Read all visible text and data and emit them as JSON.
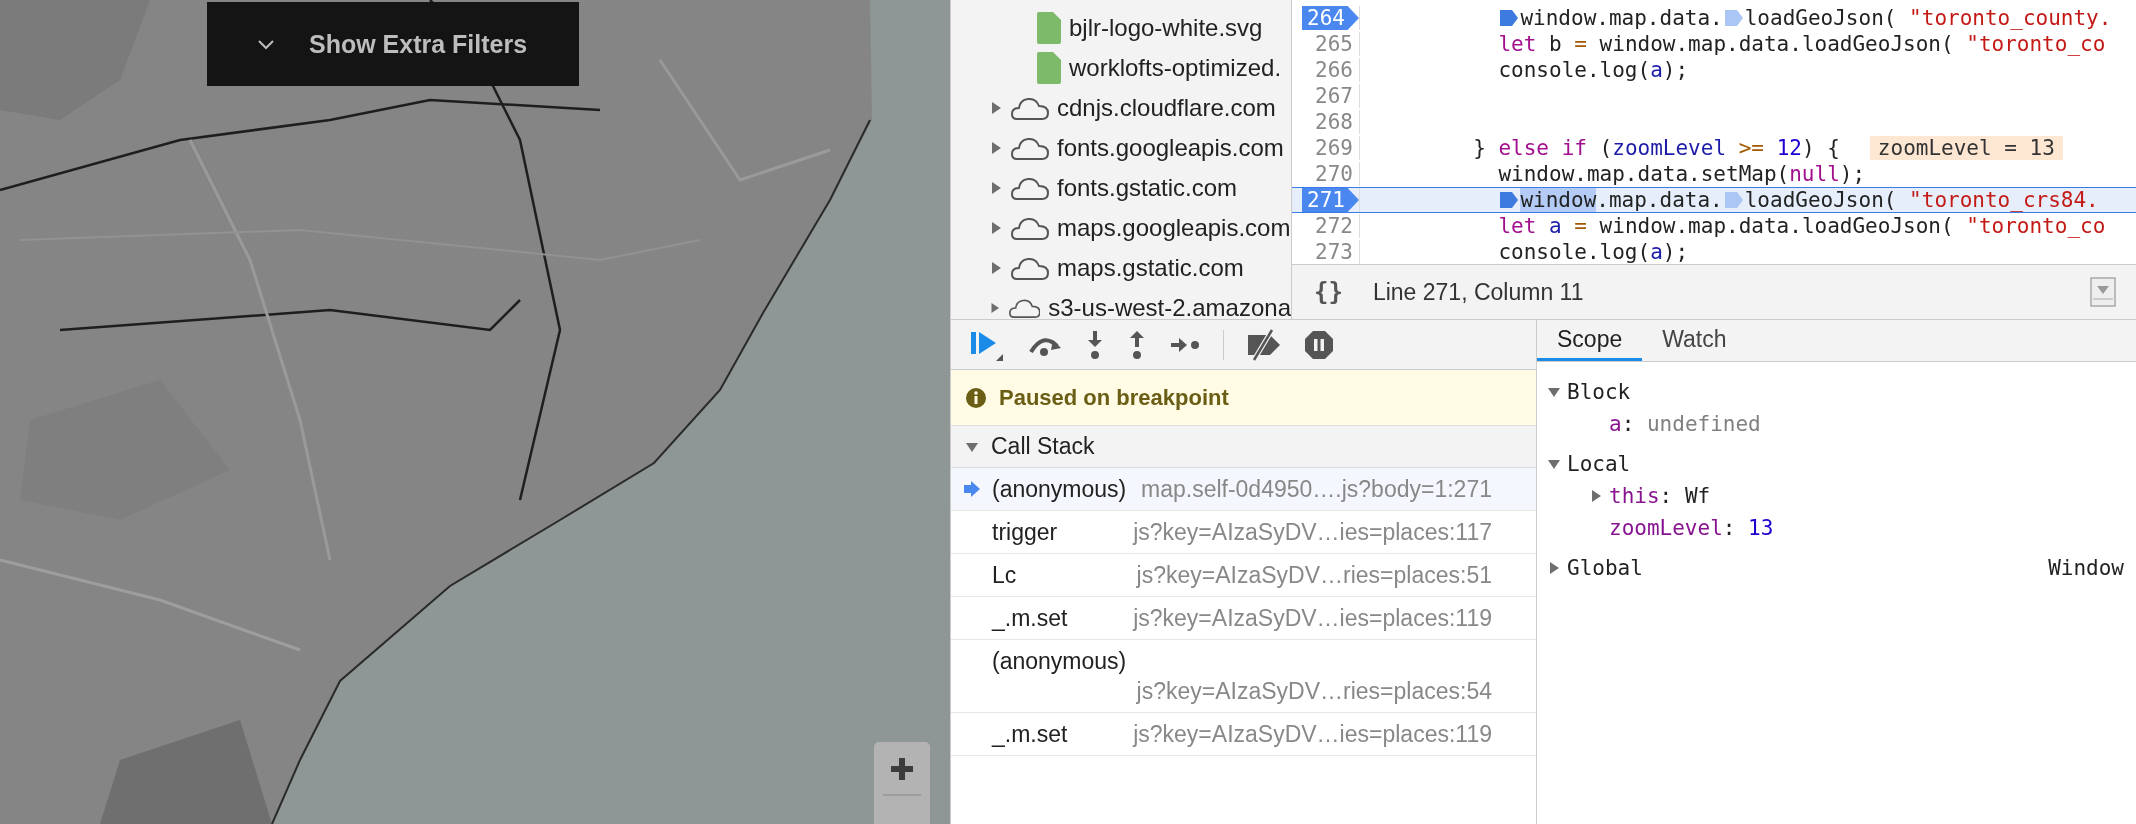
{
  "map": {
    "kind": "picture",
    "filter_button": {
      "label": "Show Extra Filters",
      "expanded": false
    }
  },
  "sources": [
    {
      "kind": "file",
      "name": "bjlr-logo-white.svg"
    },
    {
      "kind": "file",
      "name": "worklofts-optimized."
    },
    {
      "kind": "domain",
      "name": "cdnjs.cloudflare.com",
      "expanded": false
    },
    {
      "kind": "domain",
      "name": "fonts.googleapis.com",
      "expanded": false
    },
    {
      "kind": "domain",
      "name": "fonts.gstatic.com",
      "expanded": false
    },
    {
      "kind": "domain",
      "name": "maps.googleapis.com",
      "expanded": false
    },
    {
      "kind": "domain",
      "name": "maps.gstatic.com",
      "expanded": false
    },
    {
      "kind": "domain",
      "name": "s3-us-west-2.amazona",
      "expanded": false
    }
  ],
  "editor": {
    "lines": [
      {
        "number": "264",
        "breakpoint": true,
        "current": false,
        "kind": "body",
        "tokens": [
          {
            "kind": "marker",
            "active": true
          },
          {
            "kind": "plain",
            "text": "window.map.data."
          },
          {
            "kind": "marker",
            "active": false
          },
          {
            "kind": "plain",
            "text": "loadGeoJson( "
          },
          {
            "kind": "string",
            "text": "\"toronto_county."
          }
        ]
      },
      {
        "number": "265",
        "breakpoint": false,
        "current": false,
        "kind": "body",
        "tokens": [
          {
            "kind": "keyword",
            "text": "let"
          },
          {
            "kind": "plain",
            "text": " b "
          },
          {
            "kind": "operator",
            "text": "="
          },
          {
            "kind": "plain",
            "text": " window.map.data.loadGeoJson( "
          },
          {
            "kind": "string",
            "text": "\"toronto_co"
          }
        ]
      },
      {
        "number": "266",
        "breakpoint": false,
        "current": false,
        "kind": "body",
        "tokens": [
          {
            "kind": "plain",
            "text": "console.log("
          },
          {
            "kind": "variable",
            "text": "a"
          },
          {
            "kind": "plain",
            "text": ");"
          }
        ]
      },
      {
        "number": "267",
        "breakpoint": false,
        "current": false
      },
      {
        "number": "268",
        "breakpoint": false,
        "current": false
      },
      {
        "number": "269",
        "breakpoint": false,
        "current": false,
        "kind": "branch",
        "tokens": [
          {
            "kind": "plain",
            "text": "} "
          },
          {
            "kind": "keyword",
            "text": "else if"
          },
          {
            "kind": "plain",
            "text": " ("
          },
          {
            "kind": "variable",
            "text": "zoomLevel"
          },
          {
            "kind": "operator",
            "text": " >= "
          },
          {
            "kind": "number",
            "text": "12"
          },
          {
            "kind": "plain",
            "text": ") {"
          }
        ],
        "inline_value": "zoomLevel = 13"
      },
      {
        "number": "270",
        "breakpoint": false,
        "current": false,
        "kind": "body",
        "tokens": [
          {
            "kind": "plain",
            "text": "window.map.data.setMap("
          },
          {
            "kind": "keyword",
            "text": "null"
          },
          {
            "kind": "plain",
            "text": ");"
          }
        ]
      },
      {
        "number": "271",
        "breakpoint": true,
        "current": true,
        "kind": "body",
        "tokens": [
          {
            "kind": "marker",
            "active": true
          },
          {
            "kind": "selected",
            "text": "window"
          },
          {
            "kind": "plain",
            "text": ".map.data."
          },
          {
            "kind": "marker",
            "active": false
          },
          {
            "kind": "plain",
            "text": "loadGeoJson( "
          },
          {
            "kind": "string",
            "text": "\"toronto_crs84."
          }
        ]
      },
      {
        "number": "272",
        "breakpoint": false,
        "current": false,
        "kind": "body",
        "tokens": [
          {
            "kind": "keyword",
            "text": "let"
          },
          {
            "kind": "variable",
            "text": " a"
          },
          {
            "kind": "operator",
            "text": " = "
          },
          {
            "kind": "plain",
            "text": "window.map.data.loadGeoJson( "
          },
          {
            "kind": "string",
            "text": "\"toronto_co"
          }
        ]
      },
      {
        "number": "273",
        "breakpoint": false,
        "current": false,
        "kind": "body",
        "tokens": [
          {
            "kind": "plain",
            "text": "console.log("
          },
          {
            "kind": "variable",
            "text": "a"
          },
          {
            "kind": "plain",
            "text": ");"
          }
        ]
      }
    ],
    "status": {
      "format_icon": "{}",
      "position": "Line 271, Column 11"
    }
  },
  "banner": {
    "message": "Paused on breakpoint"
  },
  "call_stack": {
    "title": "Call Stack",
    "expanded": true,
    "frames": [
      {
        "name": "(anonymous)",
        "location": "map.self-0d4950….js?body=1:271",
        "selected": true
      },
      {
        "name": "trigger",
        "location": "js?key=AIzaSyDV…ies=places:117",
        "selected": false
      },
      {
        "name": "Lc",
        "location": "js?key=AIzaSyDV…ries=places:51",
        "selected": false
      },
      {
        "name": "_.m.set",
        "location": "js?key=AIzaSyDV…ies=places:119",
        "selected": false
      },
      {
        "name": "(anonymous)",
        "location": "js?key=AIzaSyDV…ries=places:54",
        "selected": false
      },
      {
        "name": "_.m.set",
        "location": "js?key=AIzaSyDV…ies=places:119",
        "selected": false
      }
    ]
  },
  "scope": {
    "tabs": [
      {
        "label": "Scope",
        "selected": true
      },
      {
        "label": "Watch",
        "selected": false
      }
    ],
    "sections": [
      {
        "name": "Block",
        "expanded": true,
        "children": [
          {
            "key": "a",
            "separator": ":",
            "value": "undefined",
            "kind": "undefined"
          }
        ]
      },
      {
        "name": "Local",
        "expanded": true,
        "children": [
          {
            "key": "this",
            "separator": ":",
            "value": "Wf",
            "kind": "object",
            "expanded": false
          },
          {
            "key": "zoomLevel",
            "separator": ":",
            "value": "13",
            "kind": "number"
          }
        ]
      },
      {
        "name": "Global",
        "expanded": false,
        "value": "Window"
      }
    ]
  }
}
